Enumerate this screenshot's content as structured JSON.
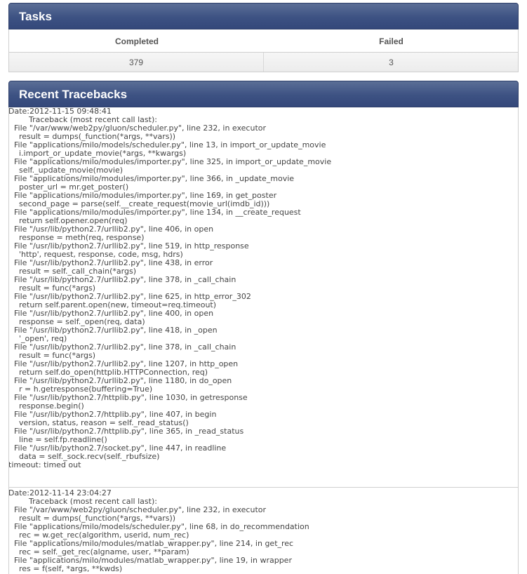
{
  "tasks": {
    "title": "Tasks",
    "columns": [
      "Completed",
      "Failed"
    ],
    "values": [
      "379",
      "3"
    ]
  },
  "tracebacks": {
    "title": "Recent Tracebacks",
    "entries": [
      {
        "date_label": "Date:2012-11-15 09:48:41",
        "text": "        Traceback (most recent call last):\n  File \"/var/www/web2py/gluon/scheduler.py\", line 232, in executor\n    result = dumps(_function(*args, **vars))\n  File \"applications/milo/models/scheduler.py\", line 13, in import_or_update_movie\n    i.import_or_update_movie(*args, **kwargs)\n  File \"applications/milo/modules/importer.py\", line 325, in import_or_update_movie\n    self._update_movie(movie)\n  File \"applications/milo/modules/importer.py\", line 366, in _update_movie\n    poster_url = mr.get_poster()\n  File \"applications/milo/modules/importer.py\", line 169, in get_poster\n    second_page = parse(self.__create_request(movie_url(imdb_id)))\n  File \"applications/milo/modules/importer.py\", line 134, in __create_request\n    return self.opener.open(req)\n  File \"/usr/lib/python2.7/urllib2.py\", line 406, in open\n    response = meth(req, response)\n  File \"/usr/lib/python2.7/urllib2.py\", line 519, in http_response\n    'http', request, response, code, msg, hdrs)\n  File \"/usr/lib/python2.7/urllib2.py\", line 438, in error\n    result = self._call_chain(*args)\n  File \"/usr/lib/python2.7/urllib2.py\", line 378, in _call_chain\n    result = func(*args)\n  File \"/usr/lib/python2.7/urllib2.py\", line 625, in http_error_302\n    return self.parent.open(new, timeout=req.timeout)\n  File \"/usr/lib/python2.7/urllib2.py\", line 400, in open\n    response = self._open(req, data)\n  File \"/usr/lib/python2.7/urllib2.py\", line 418, in _open\n    '_open', req)\n  File \"/usr/lib/python2.7/urllib2.py\", line 378, in _call_chain\n    result = func(*args)\n  File \"/usr/lib/python2.7/urllib2.py\", line 1207, in http_open\n    return self.do_open(httplib.HTTPConnection, req)\n  File \"/usr/lib/python2.7/urllib2.py\", line 1180, in do_open\n    r = h.getresponse(buffering=True)\n  File \"/usr/lib/python2.7/httplib.py\", line 1030, in getresponse\n    response.begin()\n  File \"/usr/lib/python2.7/httplib.py\", line 407, in begin\n    version, status, reason = self._read_status()\n  File \"/usr/lib/python2.7/httplib.py\", line 365, in _read_status\n    line = self.fp.readline()\n  File \"/usr/lib/python2.7/socket.py\", line 447, in readline\n    data = self._sock.recv(self._rbufsize)",
        "error": "timeout: timed out"
      },
      {
        "date_label": "Date:2012-11-14 23:04:27",
        "text": "        Traceback (most recent call last):\n  File \"/var/www/web2py/gluon/scheduler.py\", line 232, in executor\n    result = dumps(_function(*args, **vars))\n  File \"applications/milo/models/scheduler.py\", line 68, in do_recommendation\n    rec = w.get_rec(algorithm, userid, num_rec)\n  File \"applications/milo/modules/matlab_wrapper.py\", line 214, in get_rec\n    rec = self._get_rec(algname, user, **param)\n  File \"applications/milo/modules/matlab_wrapper.py\", line 19, in wrapper\n    res = f(self, *args, **kwds)",
        "error": ""
      }
    ]
  }
}
